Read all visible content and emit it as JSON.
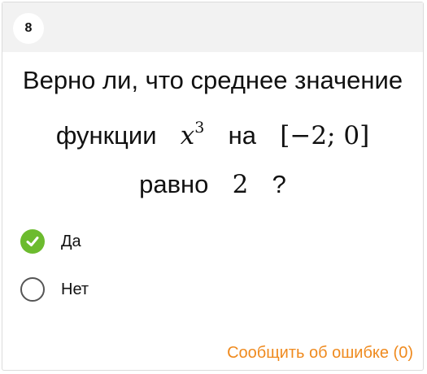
{
  "header": {
    "question_number": "8"
  },
  "question": {
    "line1": "Верно ли, что среднее значение",
    "line2_prefix": "функции",
    "math_var": "x",
    "math_exp": "3",
    "line2_mid": "на",
    "interval": "[−2; 0]",
    "line3_prefix": "равно",
    "value": "2",
    "qmark": "?"
  },
  "options": [
    {
      "label": "Да",
      "selected": true
    },
    {
      "label": "Нет",
      "selected": false
    }
  ],
  "footer": {
    "report_link": "Сообщить об ошибке (0)"
  },
  "colors": {
    "check": "#6cbb2e",
    "link": "#ef8a1e",
    "header_bg": "#f2f2f2"
  }
}
